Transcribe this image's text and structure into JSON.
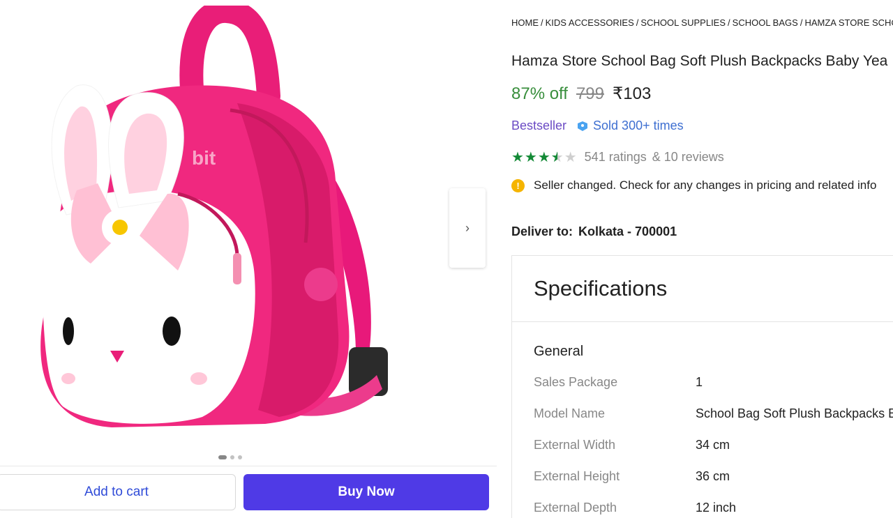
{
  "breadcrumb": [
    "HOME",
    "KIDS ACCESSORIES",
    "SCHOOL SUPPLIES",
    "SCHOOL BAGS",
    "HAMZA STORE SCHO"
  ],
  "product": {
    "title": "Hamza Store School Bag Soft Plush Backpacks Baby Yea",
    "discount": "87% off",
    "mrp": "799",
    "price": "₹103",
    "bestseller": "Bestseller",
    "sold": "Sold 300+ times",
    "rating_value": 3.5,
    "ratings": "541 ratings",
    "reviews": "& 10 reviews",
    "notice": "Seller changed. Check for any changes in pricing and related info"
  },
  "delivery": {
    "label": "Deliver to:",
    "location": "Kolkata - 700001"
  },
  "actions": {
    "add_to_cart": "Add to cart",
    "buy_now": "Buy Now"
  },
  "gallery": {
    "dots": 3,
    "active": 0
  },
  "specifications": {
    "title": "Specifications",
    "section": "General",
    "rows": [
      {
        "key": "Sales Package",
        "value": "1"
      },
      {
        "key": "Model Name",
        "value": "School Bag Soft Plush Backpacks Ba"
      },
      {
        "key": "External Width",
        "value": "34 cm"
      },
      {
        "key": "External Height",
        "value": "36 cm"
      },
      {
        "key": "External Depth",
        "value": "12 inch"
      }
    ]
  },
  "colors": {
    "accent": "#4f3ae6",
    "discount": "#388e3c",
    "star": "#138a36"
  },
  "icons": {
    "next": "chevron-right-icon",
    "info": "info-icon",
    "sold": "tag-icon"
  }
}
